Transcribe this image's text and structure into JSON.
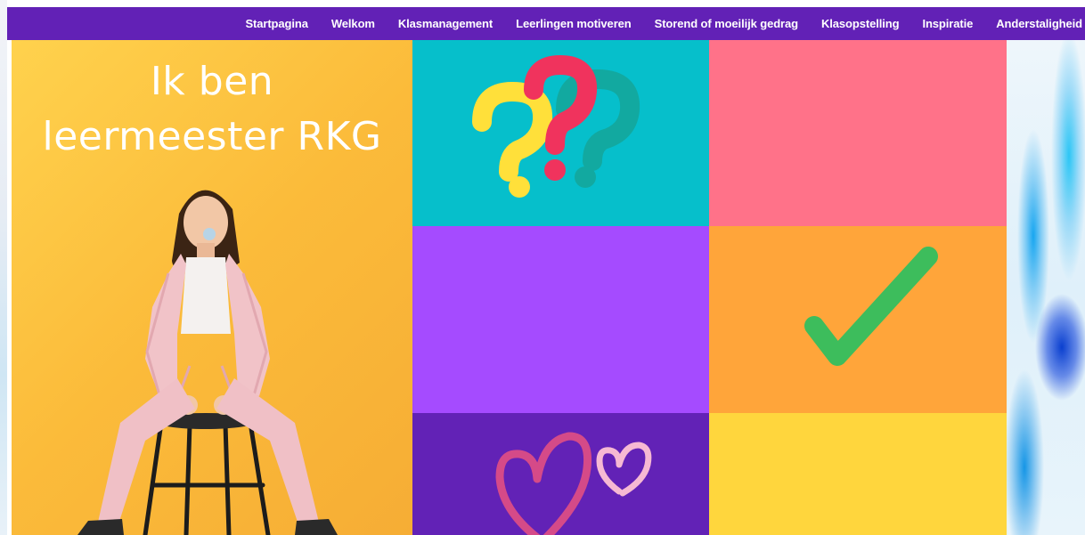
{
  "nav": {
    "items": [
      "Startpagina",
      "Welkom",
      "Klasmanagement",
      "Leerlingen motiveren",
      "Storend of moeilijk gedrag",
      "Klasopstelling",
      "Inspiratie",
      "Anderstaligheid"
    ]
  },
  "hero": {
    "title_line1": "Ik ben",
    "title_line2": "leermeester RKG"
  },
  "colors": {
    "nav_bg": "#6221b6",
    "hero_bg": "#fbbb3a",
    "tile_teal": "#06bfcb",
    "tile_pink": "#ff7289",
    "tile_violet": "#a54bff",
    "tile_orange": "#ffa53a",
    "tile_purple": "#6222b6",
    "tile_yellow": "#ffd63d",
    "checkmark": "#3dbd5c"
  },
  "icons": {
    "question_tile": "question-marks-icon",
    "check_tile": "checkmark-icon",
    "heart_tile": "hearts-icon"
  }
}
